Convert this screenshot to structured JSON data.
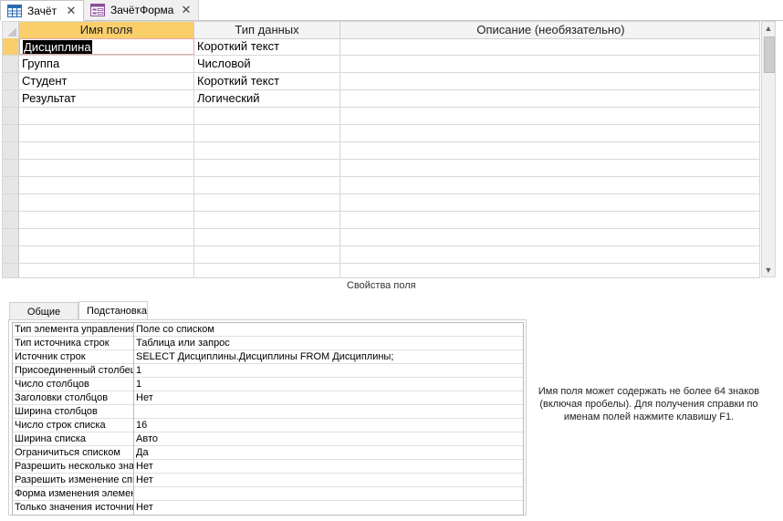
{
  "tabs": [
    {
      "label": "Зачёт",
      "active": true,
      "close": "✕",
      "icon": "table-icon"
    },
    {
      "label": "ЗачётФорма",
      "active": false,
      "close": "✕",
      "icon": "form-icon"
    }
  ],
  "grid": {
    "headers": [
      "Имя поля",
      "Тип данных",
      "Описание (необязательно)"
    ],
    "rows": [
      {
        "name": "Дисциплина",
        "type": "Короткий текст",
        "desc": ""
      },
      {
        "name": "Группа",
        "type": "Числовой",
        "desc": ""
      },
      {
        "name": "Студент",
        "type": "Короткий текст",
        "desc": ""
      },
      {
        "name": "Результат",
        "type": "Логический",
        "desc": ""
      }
    ]
  },
  "scroll": {
    "up": "▲",
    "down": "▼"
  },
  "properties": {
    "title": "Свойства поля",
    "tabs": [
      "Общие",
      "Подстановка"
    ],
    "active_tab": "Подстановка",
    "rows": [
      {
        "name": "Тип элемента управления",
        "value": "Поле со списком"
      },
      {
        "name": "Тип источника строк",
        "value": "Таблица или запрос"
      },
      {
        "name": "Источник строк",
        "value": "SELECT Дисциплины.Дисциплины FROM Дисциплины;"
      },
      {
        "name": "Присоединенный столбец",
        "value": "1"
      },
      {
        "name": "Число столбцов",
        "value": "1"
      },
      {
        "name": "Заголовки столбцов",
        "value": "Нет"
      },
      {
        "name": "Ширина столбцов",
        "value": ""
      },
      {
        "name": "Число строк списка",
        "value": "16"
      },
      {
        "name": "Ширина списка",
        "value": "Авто"
      },
      {
        "name": "Ограничиться списком",
        "value": "Да"
      },
      {
        "name": "Разрешить несколько значений",
        "value": "Нет"
      },
      {
        "name": "Разрешить изменение списка",
        "value": "Нет"
      },
      {
        "name": "Форма изменения элементов списка",
        "value": ""
      },
      {
        "name": "Только значения источника строк",
        "value": "Нет"
      }
    ]
  },
  "help_text": "Имя поля может содержать не более 64 знаков (включая пробелы). Для получения справки по именам полей нажмите клавишу F1."
}
